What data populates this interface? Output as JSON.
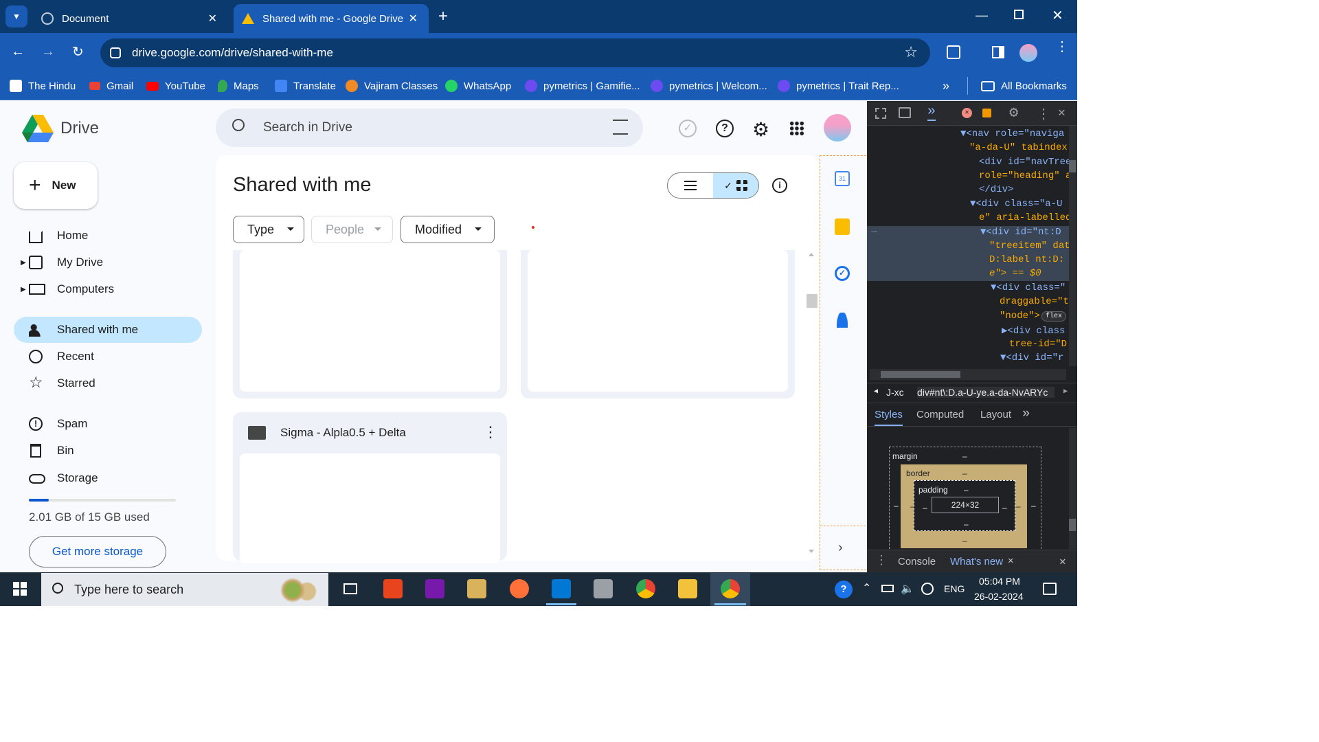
{
  "browser": {
    "tabs": [
      {
        "title": "Document",
        "active": false
      },
      {
        "title": "Shared with me - Google Drive",
        "active": true
      }
    ],
    "url": "drive.google.com/drive/shared-with-me",
    "bookmarks": [
      "The Hindu",
      "Gmail",
      "YouTube",
      "Maps",
      "Translate",
      "Vajiram Classes",
      "WhatsApp",
      "pymetrics | Gamifie...",
      "pymetrics | Welcom...",
      "pymetrics | Trait Rep..."
    ],
    "all_bookmarks": "All Bookmarks"
  },
  "drive": {
    "logo_text": "Drive",
    "search_placeholder": "Search in Drive",
    "new_label": "New",
    "nav": [
      "Home",
      "My Drive",
      "Computers",
      "Shared with me",
      "Recent",
      "Starred",
      "Spam",
      "Bin",
      "Storage"
    ],
    "storage_text": "2.01 GB of 15 GB used",
    "storage_fraction": 0.134,
    "get_storage": "Get more storage",
    "page_title": "Shared with me",
    "filters": [
      "Type",
      "People",
      "Modified"
    ],
    "folder_name": "Sigma - Alpla0.5 + Delta"
  },
  "devtools": {
    "code_lines": [
      "▼<nav role=\"naviga",
      "\"a-da-U\" tabindex",
      "<div id=\"navTree",
      "role=\"heading\" a",
      "</div>",
      "▼<div class=\"a-U",
      "e\" aria-labelled",
      "▼<div id=\"nt:D",
      "\"treeitem\" dat",
      "D:label nt:D:",
      "e\"> == $0",
      "▼<div class=\"",
      "draggable=\"t",
      "\"node\">",
      "▶<div class",
      "tree-id=\"D",
      "▼<div id=\"r"
    ],
    "flex_badge": "flex",
    "breadcrumb_left": "J-xc",
    "breadcrumb": "div#nt\\:D.a-U-ye.a-da-NvARYc",
    "tabs": [
      "Styles",
      "Computed",
      "Layout"
    ],
    "box_margin": "margin",
    "box_border": "border",
    "box_padding": "padding",
    "box_size": "224×32",
    "dash": "–",
    "console_tabs": [
      "Console",
      "What's new"
    ]
  },
  "taskbar": {
    "search_placeholder": "Type here to search",
    "lang": "ENG",
    "time": "05:04 PM",
    "date": "26-02-2024"
  }
}
